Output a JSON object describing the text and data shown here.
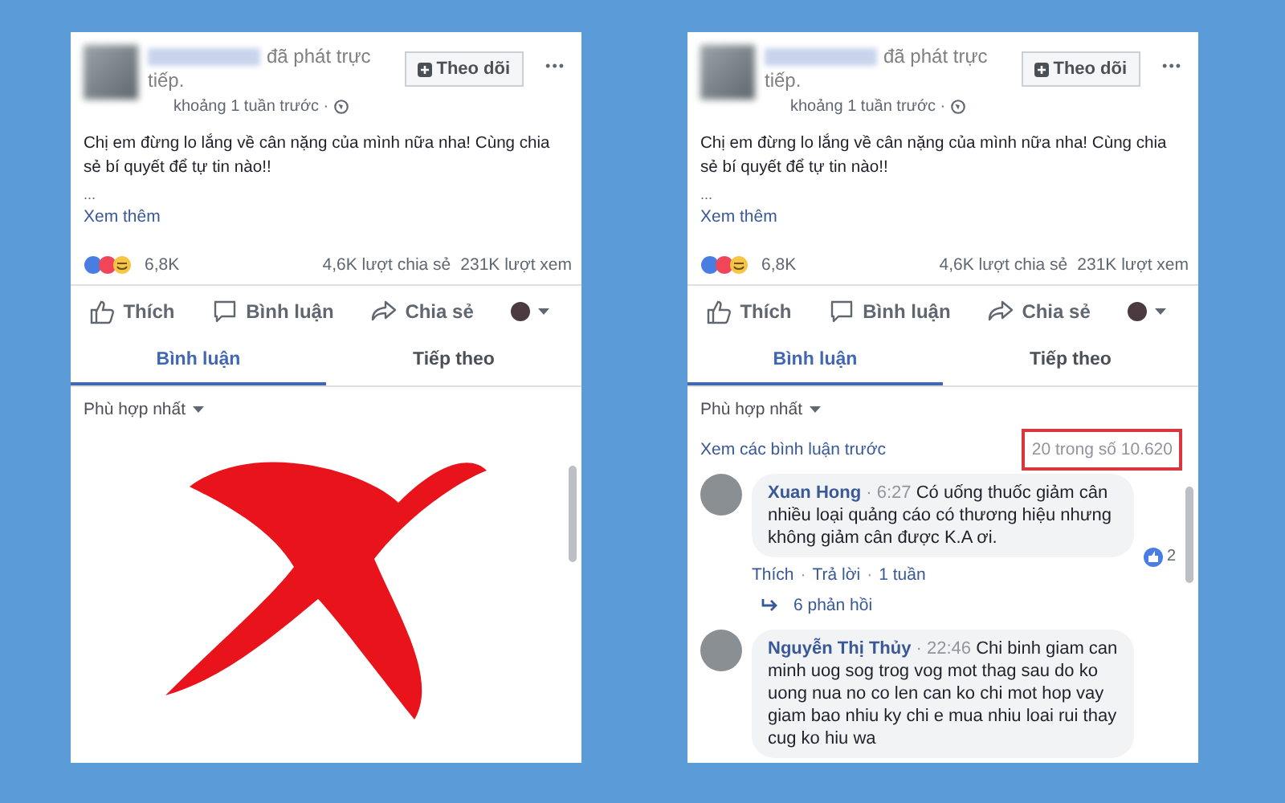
{
  "panels": [
    {
      "kind": "crossed",
      "post": {
        "author_suffix": "đã phát trực tiếp.",
        "follow": "Theo dõi",
        "more": "•••",
        "time": "khoảng 1 tuần trước ·",
        "text": "Chị em đừng lo lắng về cân nặng của mình nữa nha! Cùng chia sẻ bí quyết để tự tin nào!!",
        "ellipsis": "...",
        "see_more": "Xem thêm",
        "reaction_count": "6,8K",
        "shares": "4,6K lượt chia sẻ",
        "views": "231K lượt xem",
        "actions": [
          "Thích",
          "Bình luận",
          "Chia sẻ"
        ]
      },
      "tabs": [
        {
          "label": "Bình luận",
          "selected": true
        },
        {
          "label": "Tiếp theo",
          "selected": false
        }
      ],
      "sort": "Phù hợp nhất"
    },
    {
      "kind": "comments",
      "post": {
        "author_suffix": "đã phát trực tiếp.",
        "follow": "Theo dõi",
        "more": "•••",
        "time": "khoảng 1 tuần trước ·",
        "text": "Chị em đừng lo lắng về cân nặng của mình nữa nha! Cùng chia sẻ bí quyết để tự tin nào!!",
        "ellipsis": "...",
        "see_more": "Xem thêm",
        "reaction_count": "6,8K",
        "shares": "4,6K lượt chia sẻ",
        "views": "231K lượt xem",
        "actions": [
          "Thích",
          "Bình luận",
          "Chia sẻ"
        ]
      },
      "tabs": [
        {
          "label": "Bình luận",
          "selected": true
        },
        {
          "label": "Tiếp theo",
          "selected": false
        }
      ],
      "sort": "Phù hợp nhất",
      "previous": "Xem các bình luận trước",
      "count": {
        "text": "20 trong số 10.620",
        "highlighted": true
      },
      "comments": [
        {
          "name": "Xuan Hong",
          "time": "· 6:27",
          "separator": "·",
          "text": "Có uống thuốc giảm cân nhiều loại quảng cáo có thương hiệu nhưng không giảm cân được K.A ơi.",
          "likes": "2",
          "actions": [
            "Thích",
            "Trả lời",
            "1 tuần"
          ],
          "replies": "6 phản hồi"
        },
        {
          "name": "Nguyễn Thị Thủy",
          "time": "· 22:46",
          "text": "Chi binh giam can minh uog sog trog vog mot thag sau do ko uong nua no co len can ko chi mot hop vay giam bao nhiu ky chi e mua nhiu loai rui thay cug ko hiu wa"
        }
      ]
    }
  ]
}
